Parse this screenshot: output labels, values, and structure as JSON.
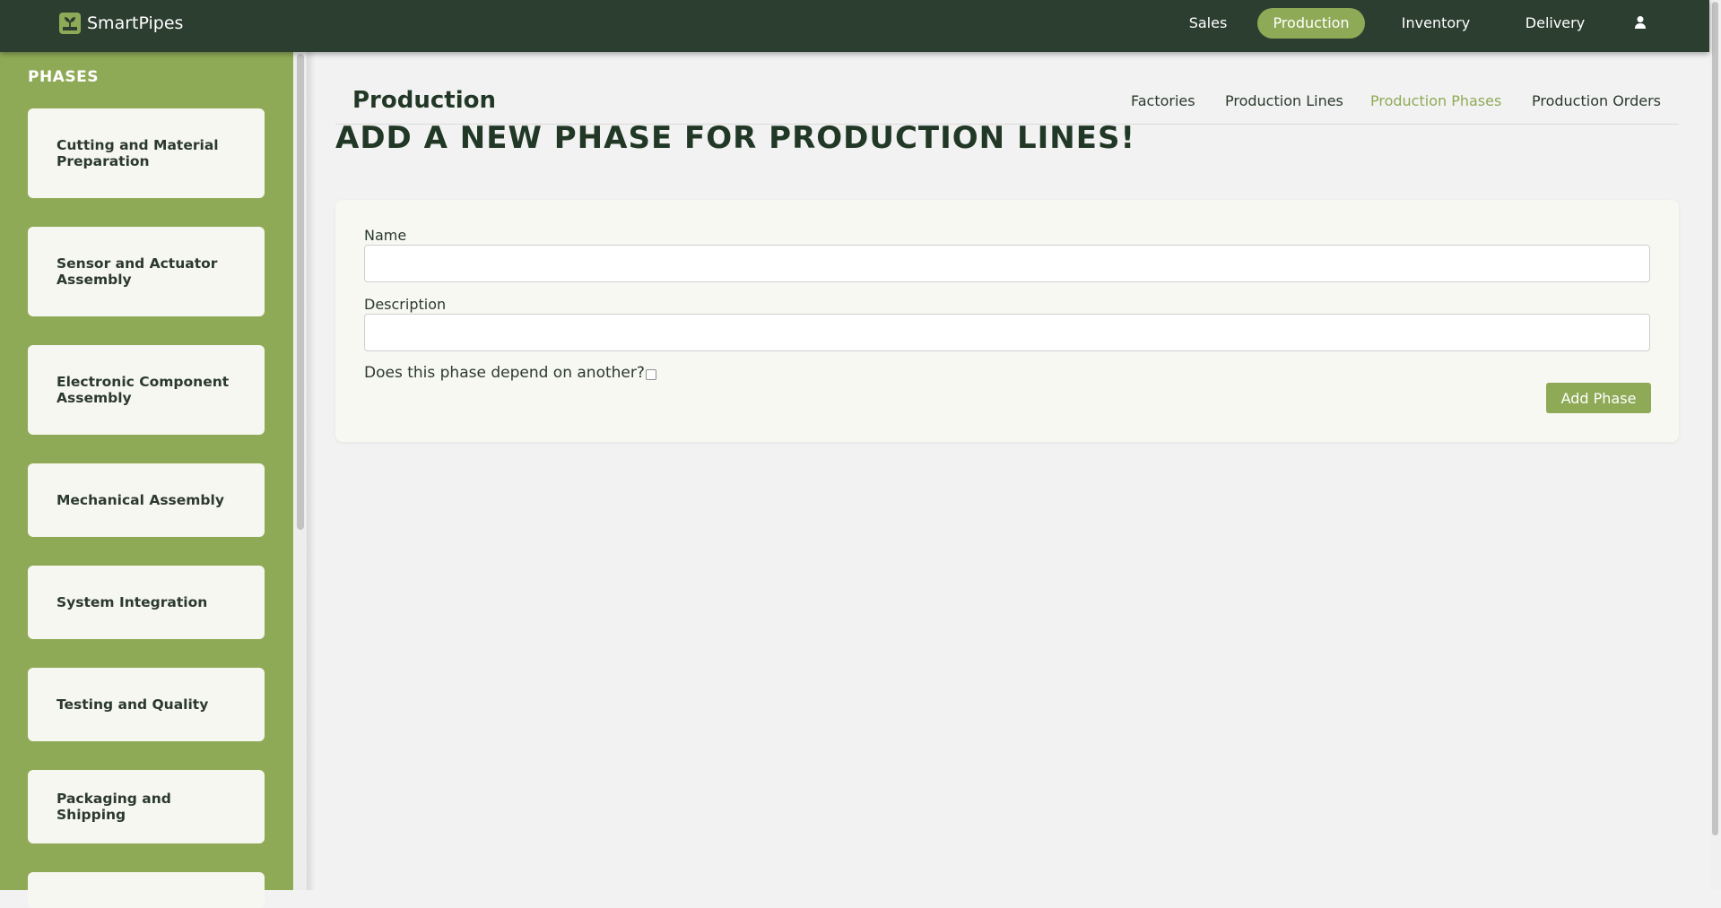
{
  "app": {
    "name": "SmartPipes",
    "logo_icon": "plant-logo-icon"
  },
  "topnav": {
    "items": [
      {
        "label": "Sales",
        "active": false
      },
      {
        "label": "Production",
        "active": true
      },
      {
        "label": "Inventory",
        "active": false
      },
      {
        "label": "Delivery",
        "active": false
      }
    ],
    "user_icon": "user-icon"
  },
  "sidebar": {
    "title": "PHASES",
    "items": [
      {
        "label": "Cutting and Material Preparation"
      },
      {
        "label": "Sensor and Actuator Assembly"
      },
      {
        "label": "Electronic Component Assembly"
      },
      {
        "label": "Mechanical Assembly"
      },
      {
        "label": "System Integration"
      },
      {
        "label": "Testing and Quality"
      },
      {
        "label": "Packaging and Shipping"
      }
    ]
  },
  "main": {
    "title": "Production",
    "subnav": [
      {
        "label": "Factories",
        "active": false
      },
      {
        "label": "Production Lines",
        "active": false
      },
      {
        "label": "Production Phases",
        "active": true
      },
      {
        "label": "Production Orders",
        "active": false
      }
    ],
    "heading": "ADD A NEW PHASE FOR PRODUCTION LINES!",
    "form": {
      "name_label": "Name",
      "name_value": "",
      "description_label": "Description",
      "description_value": "",
      "depends_label": "Does this phase depend on another?",
      "depends_checked": false,
      "submit_label": "Add Phase"
    }
  },
  "colors": {
    "topbar": "#2c3e30",
    "accent": "#8faa57",
    "card": "#f7f7f1",
    "background": "#f2f2f2"
  }
}
